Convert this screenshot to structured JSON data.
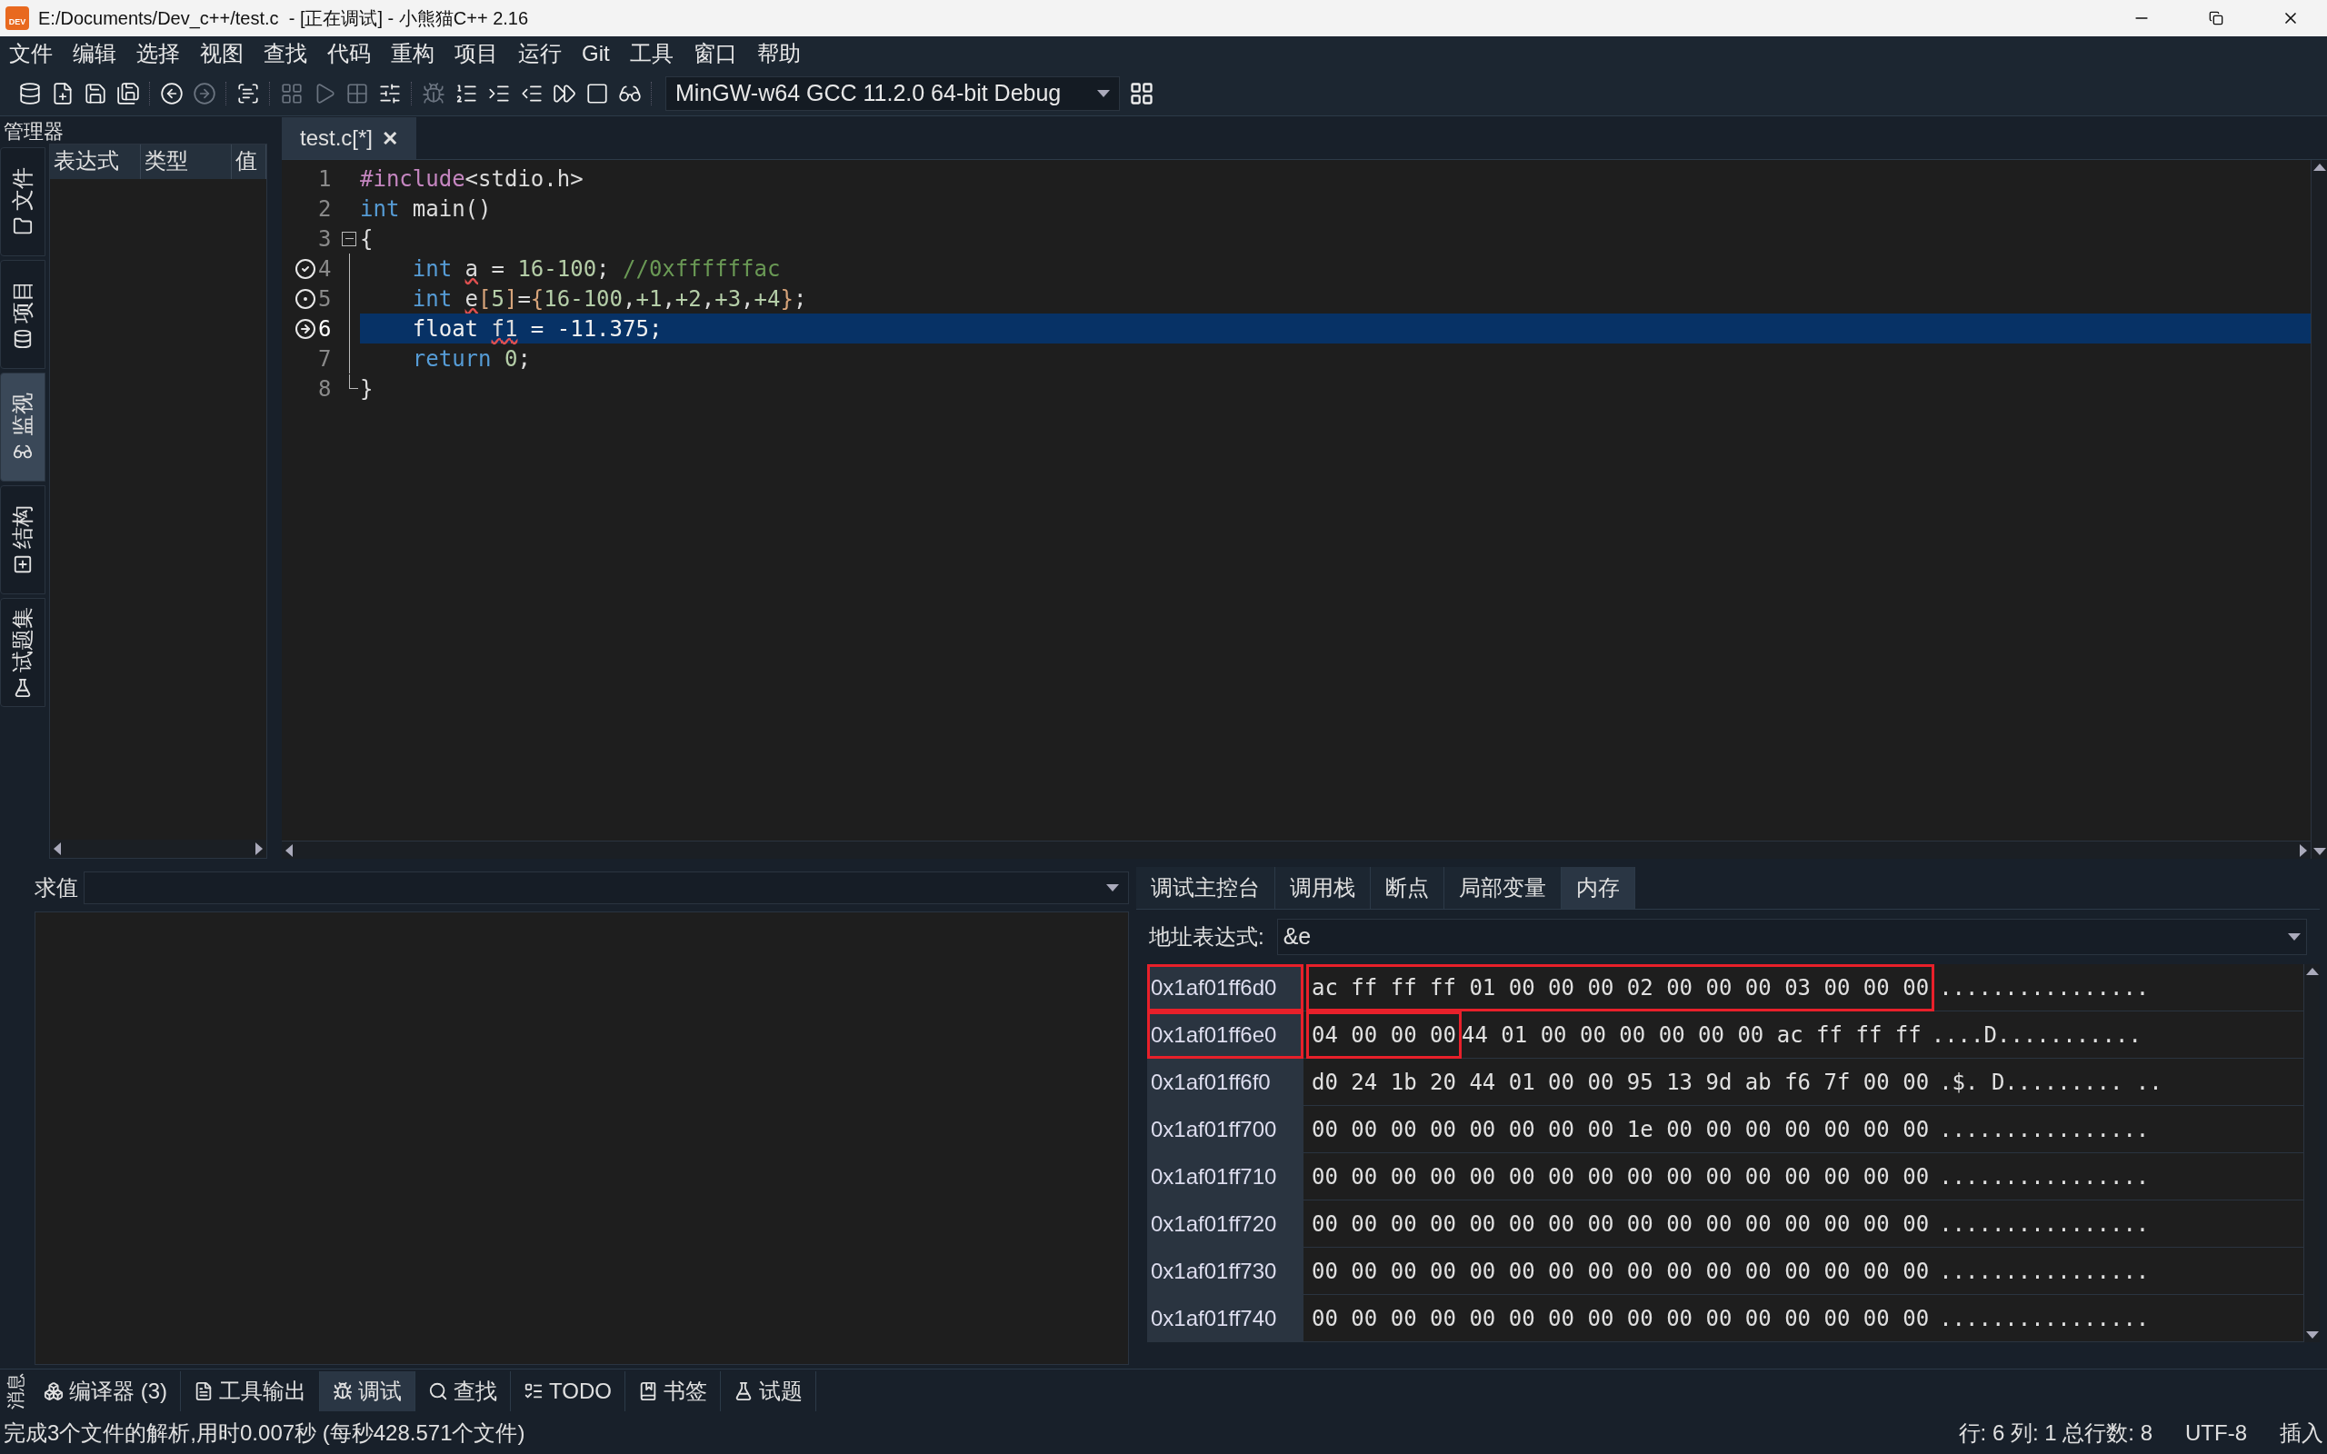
{
  "window": {
    "title": "E:/Documents/Dev_c++/test.c  - [正在调试] - 小熊猫C++ 2.16",
    "logo": "DEV"
  },
  "menu": [
    "文件",
    "编辑",
    "选择",
    "视图",
    "查找",
    "代码",
    "重构",
    "项目",
    "运行",
    "Git",
    "工具",
    "窗口",
    "帮助"
  ],
  "toolbar": [
    {
      "kind": "project",
      "disabled": false
    },
    {
      "kind": "new",
      "disabled": false
    },
    {
      "kind": "save",
      "disabled": false
    },
    {
      "kind": "saveall",
      "disabled": false
    },
    {
      "kind": "sep"
    },
    {
      "kind": "back",
      "disabled": false
    },
    {
      "kind": "forward",
      "disabled": true
    },
    {
      "kind": "sep"
    },
    {
      "kind": "format",
      "disabled": false
    },
    {
      "kind": "sep"
    },
    {
      "kind": "compile",
      "disabled": true
    },
    {
      "kind": "run",
      "disabled": true
    },
    {
      "kind": "grid",
      "disabled": true
    },
    {
      "kind": "options",
      "disabled": false
    },
    {
      "kind": "sep"
    },
    {
      "kind": "debug",
      "disabled": true
    },
    {
      "kind": "stepover",
      "disabled": false
    },
    {
      "kind": "stepinto",
      "disabled": false
    },
    {
      "kind": "stepout",
      "disabled": false
    },
    {
      "kind": "continue",
      "disabled": false
    },
    {
      "kind": "stop",
      "disabled": false
    },
    {
      "kind": "watch",
      "disabled": false
    },
    {
      "kind": "sep"
    }
  ],
  "compiler": {
    "value": "MinGW-w64 GCC 11.2.0 64-bit Debug"
  },
  "manager": {
    "title": "管理器",
    "side_tabs": [
      {
        "label": "文件",
        "kind": "folder",
        "selected": false
      },
      {
        "label": "项目",
        "kind": "project",
        "selected": false
      },
      {
        "label": "监视",
        "kind": "watch",
        "selected": true
      },
      {
        "label": "结构",
        "kind": "structure",
        "selected": false
      },
      {
        "label": "试题集",
        "kind": "problem",
        "selected": false
      }
    ],
    "columns": [
      "表达式",
      "类型",
      "值"
    ]
  },
  "editor": {
    "tabs": [
      {
        "label": "test.c[*]",
        "close": "✕",
        "selected": true
      }
    ],
    "lines": [
      {
        "number": "1",
        "current": false,
        "tokens": [
          {
            "t": "#include",
            "kind": "preproc"
          },
          {
            "t": "<stdio.h>",
            "kind": "plain"
          }
        ]
      },
      {
        "number": "2",
        "current": false,
        "tokens": [
          {
            "t": "int",
            "kind": "keyword"
          },
          {
            "t": " main()",
            "kind": "plain"
          }
        ]
      },
      {
        "number": "3",
        "current": false,
        "fold": {
          "kind": "start"
        },
        "tokens": [
          {
            "t": "{",
            "kind": "plain"
          }
        ]
      },
      {
        "number": "4",
        "gutter": {
          "kind": "check"
        },
        "current": false,
        "fold": {
          "kind": "inside"
        },
        "tokens": [
          {
            "t": "    int ",
            "kind": "keyword"
          },
          {
            "t": "a",
            "kind": "warn"
          },
          {
            "t": " = ",
            "kind": "plain"
          },
          {
            "t": "16-100",
            "kind": "number"
          },
          {
            "t": "; ",
            "kind": "plain"
          },
          {
            "t": "//0xffffffac",
            "kind": "comment"
          }
        ]
      },
      {
        "number": "5",
        "gutter": {
          "kind": "breakpoint"
        },
        "current": false,
        "fold": {
          "kind": "inside"
        },
        "tokens": [
          {
            "t": "    int ",
            "kind": "keyword"
          },
          {
            "t": "e",
            "kind": "warn"
          },
          {
            "t": "[",
            "kind": "bracket"
          },
          {
            "t": "5",
            "kind": "number"
          },
          {
            "t": "]",
            "kind": "bracket"
          },
          {
            "t": "=",
            "kind": "plain"
          },
          {
            "t": "{",
            "kind": "bracket"
          },
          {
            "t": "16-100",
            "kind": "number"
          },
          {
            "t": ",",
            "kind": "plain"
          },
          {
            "t": "+1",
            "kind": "number"
          },
          {
            "t": ",",
            "kind": "plain"
          },
          {
            "t": "+2",
            "kind": "number"
          },
          {
            "t": ",",
            "kind": "plain"
          },
          {
            "t": "+3",
            "kind": "number"
          },
          {
            "t": ",",
            "kind": "plain"
          },
          {
            "t": "+4",
            "kind": "number"
          },
          {
            "t": "}",
            "kind": "bracket"
          },
          {
            "t": ";",
            "kind": "plain"
          }
        ]
      },
      {
        "number": "6",
        "gutter": {
          "kind": "current"
        },
        "current": true,
        "fold": {
          "kind": "inside"
        },
        "tokens": [
          {
            "t": "    float ",
            "kind": "plain"
          },
          {
            "t": "f1",
            "kind": "warn"
          },
          {
            "t": " = -11.375;",
            "kind": "plain"
          }
        ]
      },
      {
        "number": "7",
        "current": false,
        "fold": {
          "kind": "inside"
        },
        "tokens": [
          {
            "t": "    return ",
            "kind": "keyword"
          },
          {
            "t": "0",
            "kind": "number"
          },
          {
            "t": ";",
            "kind": "plain"
          }
        ]
      },
      {
        "number": "8",
        "current": false,
        "fold": {
          "kind": "end"
        },
        "tokens": [
          {
            "t": "}",
            "kind": "plain"
          }
        ]
      }
    ]
  },
  "evaluate": {
    "label": "求值"
  },
  "debug": {
    "tabs": [
      {
        "label": "调试主控台",
        "selected": false
      },
      {
        "label": "调用栈",
        "selected": false
      },
      {
        "label": "断点",
        "selected": false
      },
      {
        "label": "局部变量",
        "selected": false
      },
      {
        "label": "内存",
        "selected": true
      }
    ],
    "address_label": "地址表达式:",
    "address_value": "&e",
    "rows": [
      {
        "address": "0x1af01ff6d0",
        "marked": true,
        "groups": [
          {
            "bytes": "ac ff ff ff 01 00 00 00 02 00 00 00 03 00 00 00",
            "marked": true
          }
        ],
        "ascii": "................"
      },
      {
        "address": "0x1af01ff6e0",
        "marked": true,
        "groups": [
          {
            "bytes": "04 00 00 00",
            "marked": true
          },
          {
            "bytes": "44 01 00 00 00 00 00 00 ac ff ff ff",
            "marked": false
          }
        ],
        "ascii": "....D..........."
      },
      {
        "address": "0x1af01ff6f0",
        "marked": false,
        "groups": [
          {
            "bytes": "d0 24 1b 20 44 01 00 00 95 13 9d ab f6 7f 00 00",
            "marked": false
          }
        ],
        "ascii": ".$. D......... .."
      },
      {
        "address": "0x1af01ff700",
        "marked": false,
        "groups": [
          {
            "bytes": "00 00 00 00 00 00 00 00 1e 00 00 00 00 00 00 00",
            "marked": false
          }
        ],
        "ascii": "................"
      },
      {
        "address": "0x1af01ff710",
        "marked": false,
        "groups": [
          {
            "bytes": "00 00 00 00 00 00 00 00 00 00 00 00 00 00 00 00",
            "marked": false
          }
        ],
        "ascii": "................"
      },
      {
        "address": "0x1af01ff720",
        "marked": false,
        "groups": [
          {
            "bytes": "00 00 00 00 00 00 00 00 00 00 00 00 00 00 00 00",
            "marked": false
          }
        ],
        "ascii": "................"
      },
      {
        "address": "0x1af01ff730",
        "marked": false,
        "groups": [
          {
            "bytes": "00 00 00 00 00 00 00 00 00 00 00 00 00 00 00 00",
            "marked": false
          }
        ],
        "ascii": "................"
      },
      {
        "address": "0x1af01ff740",
        "marked": false,
        "groups": [
          {
            "bytes": "00 00 00 00 00 00 00 00 00 00 00 00 00 00 00 00",
            "marked": false
          }
        ],
        "ascii": "................"
      }
    ]
  },
  "bottom": {
    "side_label": "消息",
    "tabs": [
      {
        "label": "编译器 (3)",
        "kind": "compiler",
        "selected": false
      },
      {
        "label": "工具输出",
        "kind": "tools",
        "selected": false
      },
      {
        "label": "调试",
        "kind": "debug",
        "selected": true
      },
      {
        "label": "查找",
        "kind": "search",
        "selected": false
      },
      {
        "label": "TODO",
        "kind": "todo",
        "selected": false
      },
      {
        "label": "书签",
        "kind": "bookmark",
        "selected": false
      },
      {
        "label": "试题",
        "kind": "problem",
        "selected": false
      }
    ]
  },
  "status_bar": {
    "message": "完成3个文件的解析,用时0.007秒 (每秒428.571个文件)",
    "position": "行: 6 列: 1 总行数: 8",
    "encoding": "UTF-8",
    "mode": "插入"
  }
}
